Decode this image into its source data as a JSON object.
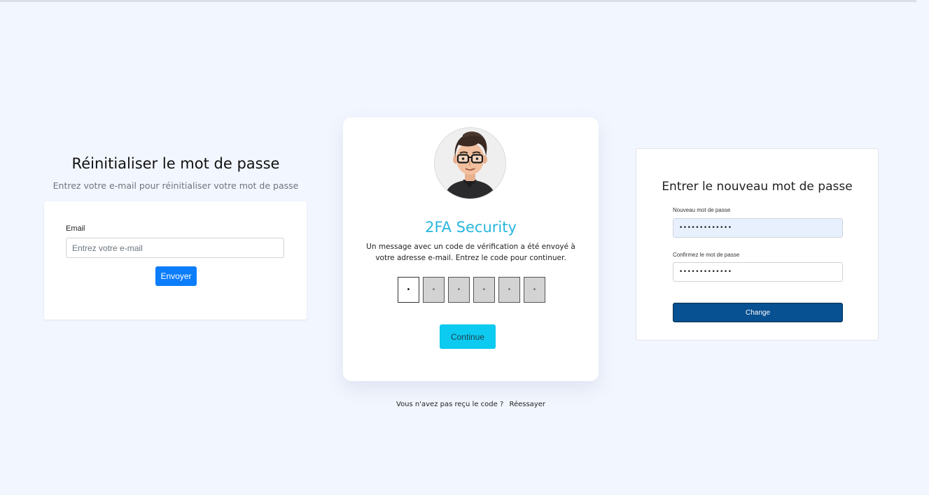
{
  "reset_password": {
    "title": "Réinitialiser le mot de passe",
    "subtitle": "Entrez votre e-mail pour réinitialiser votre mot de passe",
    "email_label": "Email",
    "email_placeholder": "Entrez votre e-mail",
    "email_value": "",
    "send_label": "Envoyer"
  },
  "two_factor": {
    "avatar_icon": "user-avatar-glasses-icon",
    "title": "2FA Security",
    "message": "Un message avec un code de vérification a été envoyé à votre adresse e-mail. Entrez le code pour continuer.",
    "code_digits": [
      "•",
      "•",
      "•",
      "•",
      "•",
      "•"
    ],
    "continue_label": "Continue",
    "resend_prompt": "Vous n'avez pas reçu le code ?",
    "resend_link": "Réessayer"
  },
  "new_password": {
    "title": "Entrer le nouveau mot de passe",
    "new_label": "Nouveau mot de passe",
    "new_value": "•••••••••••••",
    "confirm_label": "Confirmez le mot de passe",
    "confirm_value": "•••••••••••••",
    "change_label": "Change"
  },
  "colors": {
    "background": "#f2f6fe",
    "primary_blue": "#0b7dfb",
    "cyan_button": "#0dcaf0",
    "title_cyan": "#29b6dd",
    "dark_blue_button": "#075092",
    "autofill_blue": "#e8f0fe"
  }
}
